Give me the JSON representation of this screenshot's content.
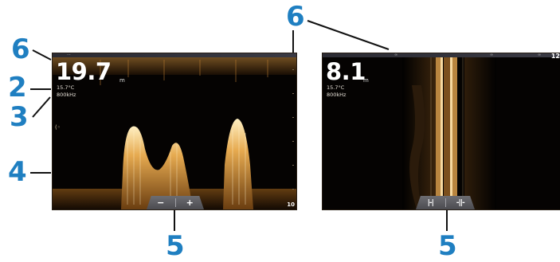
{
  "callouts": {
    "left_top": "6",
    "left_mid": "2",
    "left_lower": "3",
    "left_bottom": "4",
    "bottom_left": "5",
    "bottom_right": "5",
    "top_right": "6"
  },
  "left_screen": {
    "depth_value": "19.7",
    "depth_unit": "m",
    "temperature": "15.7°C",
    "frequency": "800kHz",
    "range_scale": "10",
    "buttons": {
      "zoom_out": "−",
      "zoom_in": "+"
    }
  },
  "right_screen": {
    "depth_value": "8.1",
    "depth_unit": "m",
    "temperature": "15.7°C",
    "frequency": "800kHz",
    "range_corner": "12",
    "buttons": {
      "narrow_range_icon": "range-narrow-icon",
      "wide_range_icon": "range-wide-icon"
    }
  },
  "colors": {
    "callout": "#1f7fc1",
    "sonar_bright": "#f6c56a",
    "sonar_mid": "#b87a2a",
    "background": "#050302"
  }
}
